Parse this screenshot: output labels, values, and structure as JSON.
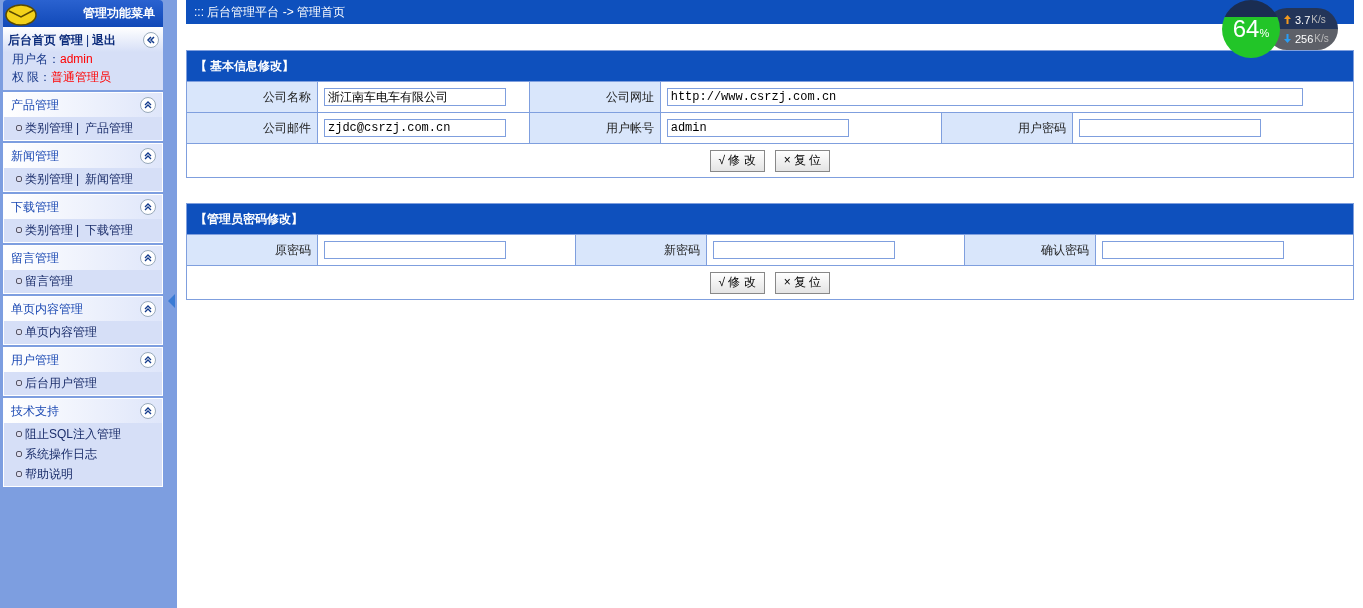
{
  "sidebar": {
    "title": "管理功能菜单",
    "top_links": [
      {
        "kind": "link",
        "text": "后台首页"
      },
      {
        "kind": "link",
        "text": "管理"
      },
      {
        "kind": "separator",
        "text": "|"
      },
      {
        "kind": "link",
        "text": "退出"
      }
    ],
    "user": [
      {
        "label": "用户名：",
        "value": "admin"
      },
      {
        "label": "权 限：",
        "value": "普通管理员"
      }
    ],
    "groups": [
      {
        "title": "产品管理",
        "rows": [
          [
            {
              "kind": "link",
              "text": "类别管理"
            },
            {
              "kind": "separator",
              "text": "|"
            },
            {
              "kind": "link",
              "text": "产品管理"
            }
          ]
        ]
      },
      {
        "title": "新闻管理",
        "rows": [
          [
            {
              "kind": "link",
              "text": "类别管理"
            },
            {
              "kind": "separator",
              "text": "|"
            },
            {
              "kind": "link",
              "text": "新闻管理"
            }
          ]
        ]
      },
      {
        "title": "下载管理",
        "rows": [
          [
            {
              "kind": "link",
              "text": "类别管理"
            },
            {
              "kind": "separator",
              "text": "|"
            },
            {
              "kind": "link",
              "text": "下载管理"
            }
          ]
        ]
      },
      {
        "title": "留言管理",
        "rows": [
          [
            {
              "kind": "link",
              "text": "留言管理"
            }
          ]
        ]
      },
      {
        "title": "单页内容管理",
        "rows": [
          [
            {
              "kind": "link",
              "text": "单页内容管理"
            }
          ]
        ]
      },
      {
        "title": "用户管理",
        "rows": [
          [
            {
              "kind": "link",
              "text": "后台用户管理"
            }
          ]
        ]
      },
      {
        "title": "技术支持",
        "rows": [
          [
            {
              "kind": "link",
              "text": "阻止SQL注入管理"
            }
          ],
          [
            {
              "kind": "link",
              "text": "系统操作日志"
            }
          ],
          [
            {
              "kind": "link",
              "text": "帮助说明"
            }
          ]
        ]
      }
    ]
  },
  "breadcrumb": ":::  后台管理平台 -> 管理首页",
  "sections": [
    {
      "title": "【 基本信息修改】",
      "rows": [
        [
          {
            "label": "公司名称",
            "value": "浙江南车电车有限公司",
            "wide": false
          },
          {
            "label": "公司网址",
            "value": "http://www.csrzj.com.cn",
            "wide": true
          }
        ],
        [
          {
            "label": "公司邮件",
            "value": "zjdc@csrzj.com.cn",
            "wide": false
          },
          {
            "label": "用户帐号",
            "value": "admin",
            "wide": false
          },
          {
            "label": "用户密码",
            "wide": false
          }
        ]
      ],
      "buttons": [
        {
          "icon": "√",
          "label": "修 改"
        },
        {
          "icon": "×",
          "label": "复 位"
        }
      ]
    },
    {
      "title": "【管理员密码修改】",
      "rows": [
        [
          {
            "label": "原密码",
            "wide": false
          },
          {
            "label": "新密码",
            "wide": false
          },
          {
            "label": "确认密码",
            "wide": false
          }
        ]
      ],
      "buttons": [
        {
          "icon": "√",
          "label": "修 改"
        },
        {
          "icon": "×",
          "label": "复 位"
        }
      ]
    }
  ],
  "speed_widget": {
    "percent": "64",
    "percent_unit": "%",
    "upload": "3.7",
    "upload_unit": "K/s",
    "download": "256",
    "download_unit": "K/s"
  }
}
